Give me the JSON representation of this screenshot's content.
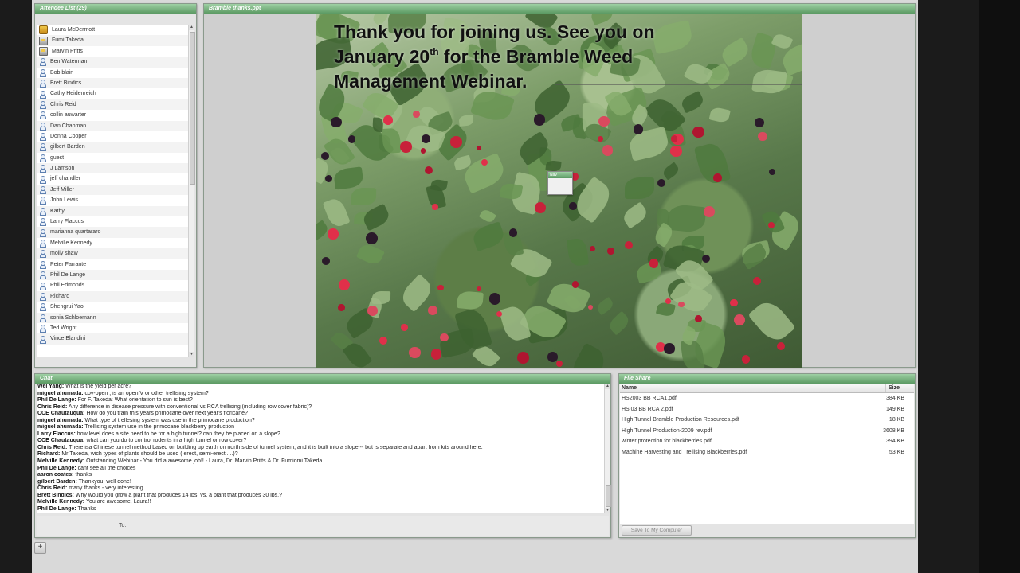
{
  "attendees": {
    "title": "Attendee List (29)",
    "items": [
      {
        "name": "Laura McDermott",
        "role": "host"
      },
      {
        "name": "Fumi Takeda",
        "role": "presenter"
      },
      {
        "name": "Marvin Pritts",
        "role": "presenter"
      },
      {
        "name": "Ben Waterman",
        "role": "user"
      },
      {
        "name": "Bob blain",
        "role": "user"
      },
      {
        "name": "Brett Bindics",
        "role": "user"
      },
      {
        "name": "Cathy Heidenreich",
        "role": "user"
      },
      {
        "name": "Chris Reid",
        "role": "user"
      },
      {
        "name": "collin auwarter",
        "role": "user"
      },
      {
        "name": "Dan Chapman",
        "role": "user"
      },
      {
        "name": "Donna Cooper",
        "role": "user"
      },
      {
        "name": "gilbert Barden",
        "role": "user"
      },
      {
        "name": "guest",
        "role": "user"
      },
      {
        "name": "J Lamson",
        "role": "user"
      },
      {
        "name": "jeff chandler",
        "role": "user"
      },
      {
        "name": "Jeff Miller",
        "role": "user"
      },
      {
        "name": "John Lewis",
        "role": "user"
      },
      {
        "name": "Kathy",
        "role": "user"
      },
      {
        "name": "Larry Flaccus",
        "role": "user"
      },
      {
        "name": "marianna quartararo",
        "role": "user"
      },
      {
        "name": "Melville Kennedy",
        "role": "user"
      },
      {
        "name": "molly shaw",
        "role": "user"
      },
      {
        "name": "Peter Farrante",
        "role": "user"
      },
      {
        "name": "Phil De Lange",
        "role": "user"
      },
      {
        "name": "Phil Edmonds",
        "role": "user"
      },
      {
        "name": "Richard",
        "role": "user"
      },
      {
        "name": "Shengrui Yao",
        "role": "user"
      },
      {
        "name": "sonia Schloemann",
        "role": "user"
      },
      {
        "name": "Ted Wright",
        "role": "user"
      },
      {
        "name": "Vince Blandini",
        "role": "user"
      }
    ]
  },
  "share": {
    "title": "Bramble thanks.ppt",
    "slide_line1": "Thank you for joining us.  See you on",
    "slide_line2_pre": "January 20",
    "slide_line2_sup": "th",
    "slide_line2_post": " for the Bramble Weed",
    "slide_line3": "Management Webinar.",
    "tag_label": "Nav"
  },
  "chat": {
    "title": "Chat",
    "to_label": "To:",
    "messages": [
      {
        "sender": "Wei Yang:",
        "text": " What is the yield per acre?"
      },
      {
        "sender": "miguel ahumada:",
        "text": " cov-open , is an open V or other trellising system?"
      },
      {
        "sender": "Phil De Lange:",
        "text": " For F. Takeda: What orientation to sun is best?"
      },
      {
        "sender": "Chris Reid:",
        "text": " Any difference in disease pressure with conventional vs RCA trellising (including row cover fabric)?"
      },
      {
        "sender": "CCE Chautauqua:",
        "text": " How do you train this years primocane over next year's floricane?"
      },
      {
        "sender": "miguel ahumada:",
        "text": " What type of trellesing system was use in the primocane production?"
      },
      {
        "sender": "miguel ahumada:",
        "text": " Trellising system use in the primocane blackberry production"
      },
      {
        "sender": "Larry Flaccus:",
        "text": " how level  does a site need to be for a high tunnel? can they be placed on a slope?"
      },
      {
        "sender": "CCE Chautauqua:",
        "text": " what can you do to control rodents in a high tunnel or row cover?"
      },
      {
        "sender": "Chris Reid:",
        "text": " There isa Chinese tunnel method based on building up earth on north side of tunnel system, and it is built into a slope -- but is separate and apart from kits around here."
      },
      {
        "sender": "Richard:",
        "text": " Mr Takeda, wich types of plants should be used ( erect, semi-erect.....)?"
      },
      {
        "sender": "Melville Kennedy:",
        "text": " Outstanding Webinar - You did a awesome job!! - Laura,  Dr. Marvin Pritts & Dr. Fumiomi Takeda"
      },
      {
        "sender": "Phil De Lange:",
        "text": " cant see all the choices"
      },
      {
        "sender": "aaron coates:",
        "text": " thanks"
      },
      {
        "sender": "gilbert Barden:",
        "text": " Thankyou, well done!"
      },
      {
        "sender": "Chris Reid:",
        "text": " many thanks - very interesting"
      },
      {
        "sender": "Brett Bindics:",
        "text": " Why would you grow a plant that produces 14 lbs. vs. a plant that produces 30 lbs.?"
      },
      {
        "sender": "Melville Kennedy:",
        "text": " You are awesome, Laura!!"
      },
      {
        "sender": "Phil De Lange:",
        "text": " Thanks"
      }
    ]
  },
  "files": {
    "title": "File Share",
    "col_name": "Name",
    "col_size": "Size",
    "items": [
      {
        "name": "HS2003 BB RCA1.pdf",
        "size": "384 KB"
      },
      {
        "name": "HS 03 BB RCA 2.pdf",
        "size": "149 KB"
      },
      {
        "name": "High Tunnel Bramble Production Resources.pdf",
        "size": "18 KB"
      },
      {
        "name": "High Tunnel Production-2009 rev.pdf",
        "size": "3608 KB"
      },
      {
        "name": "winter protection for blackberries.pdf",
        "size": "394 KB"
      },
      {
        "name": "Machine Harvesting and Trellising Blackberries.pdf",
        "size": "53 KB"
      }
    ],
    "save_label": "Save To My Computer"
  },
  "footer": {
    "add_label": "+"
  },
  "colors": {
    "pod_header": "#5b9a63",
    "workspace": "#d9d9d9"
  }
}
